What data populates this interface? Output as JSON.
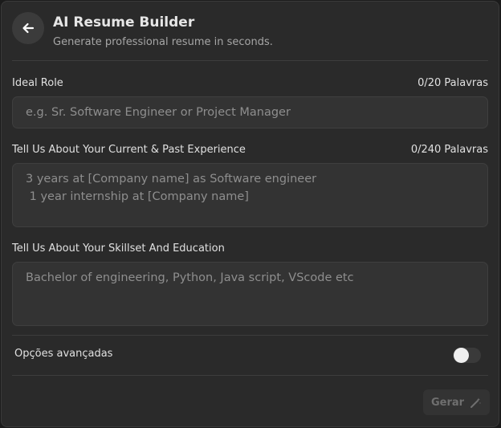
{
  "header": {
    "back_icon": "arrow-left-icon",
    "title": "AI Resume Builder",
    "subtitle": "Generate professional resume in seconds."
  },
  "form": {
    "role": {
      "label": "Ideal Role",
      "counter": "0/20 Palavras",
      "placeholder": "e.g. Sr. Software Engineer or Project Manager"
    },
    "experience": {
      "label": "Tell Us About Your Current & Past Experience",
      "counter": "0/240 Palavras",
      "placeholder": "3 years at [Company name] as Software engineer\n 1 year internship at [Company name]"
    },
    "skills": {
      "label": "Tell Us About Your Skillset And Education",
      "placeholder": "Bachelor of engineering, Python, Java script, VScode etc"
    }
  },
  "advanced": {
    "label": "Opções avançadas",
    "toggle_on": false
  },
  "actions": {
    "generate_label": "Gerar",
    "generate_icon": "magic-wand-icon"
  }
}
